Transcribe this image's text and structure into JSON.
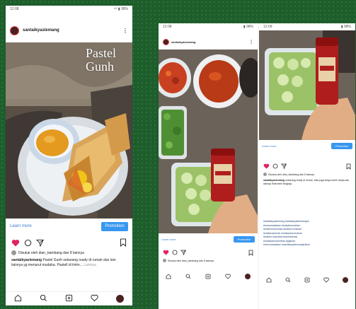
{
  "left_post": {
    "status_time": "12:08",
    "status_right": "⁵ᴳ ▮ 98%",
    "account": "santaikyaslemang",
    "overlay_title": "Pastel Gunh",
    "learn_more": "Learn more",
    "promo_button": "Promotion",
    "likes_text": "Disukai oleh dian_bambang dan 8 lainnya",
    "caption_user": "santaikyaslemang",
    "caption_text": "Pastel Gunh sekarang ready di rumah dan lain lainnya yg menurut mudaha. Pastell di kirim...",
    "caption_more": "Lainnya"
  },
  "right_post_a": {
    "status_time": "12:08",
    "status_right": "▮ 98%",
    "account": "santaikyaslemang",
    "learn_more": "Learn more",
    "promo_button": "Promotion",
    "likes_text": "Disukai oleh dian_bambang dan 8 lainnya"
  },
  "right_post_b": {
    "status_time": "12:09",
    "status_right": "▮ 98%",
    "learn_more": "Learn more",
    "promo_button": "Promotion",
    "likes_text": "Disukai oleh dian_bambang dan 8 lainnya",
    "caption_user": "santaikyaslemang",
    "caption_text": "sekarang ready di rumah, bisa juga tanya boleh tanya dan lainnya lihat lebih lengkap.",
    "hashtags": [
      "#santaikyaslemang #santaikyaslemanguk",
      "#resepmasakan #masakrumahan",
      "#kulinerindonesia #kulinerrumahan",
      "#makananenak #makananrumahan",
      "#kuliner #sambal #sambelenak",
      "#masakanindonesia #jajanan",
      "#menumasakan #santaikyaslemangkuliner"
    ]
  }
}
